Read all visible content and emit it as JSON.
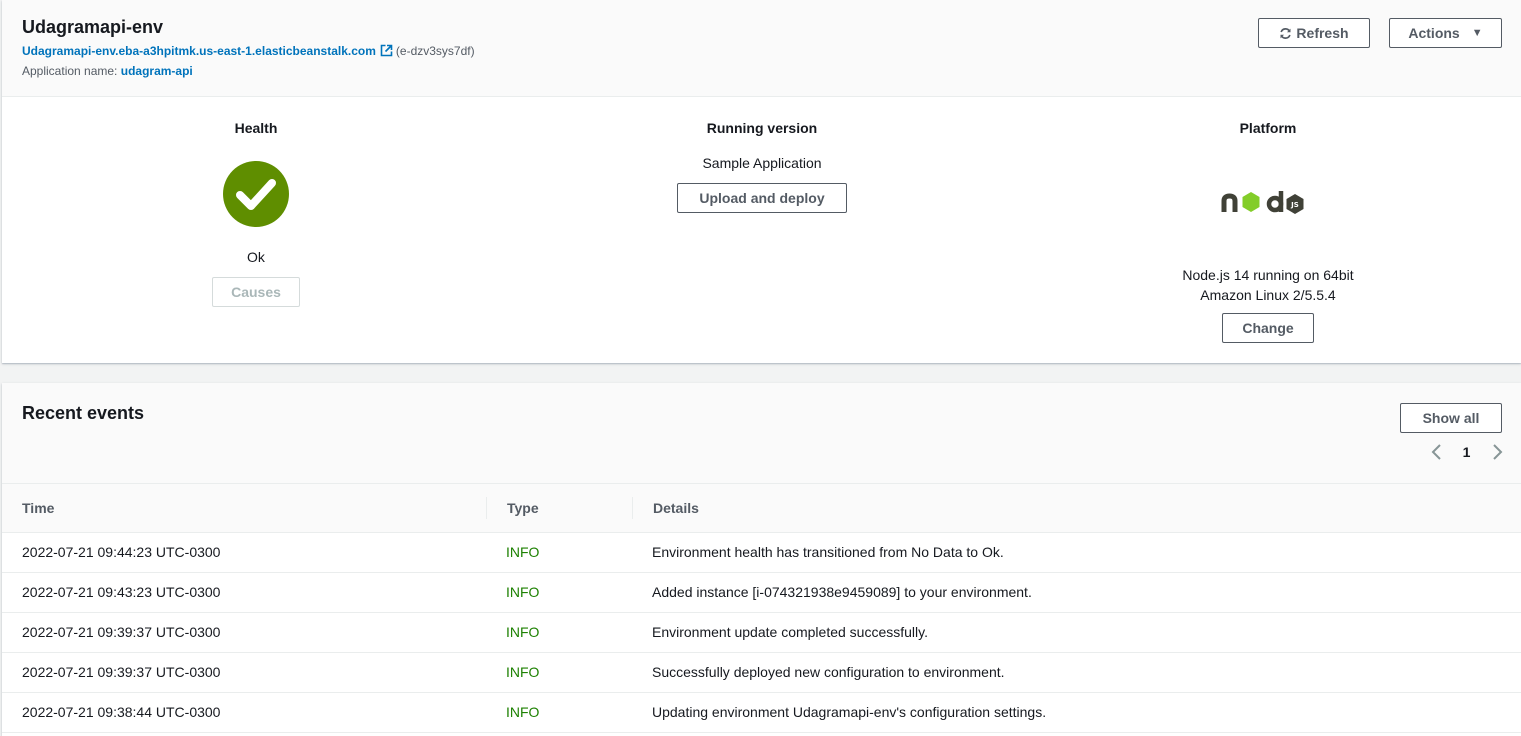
{
  "env": {
    "title": "Udagramapi-env",
    "url": "Udagramapi-env.eba-a3hpitmk.us-east-1.elasticbeanstalk.com",
    "env_id": "(e-dzv3sys7df)",
    "app_label": "Application name:",
    "app_name": "udagram-api",
    "refresh_label": "Refresh",
    "actions_label": "Actions"
  },
  "health": {
    "title": "Health",
    "status": "Ok",
    "causes_label": "Causes",
    "color": "#5f8e00"
  },
  "running_version": {
    "title": "Running version",
    "value": "Sample Application",
    "upload_label": "Upload and deploy"
  },
  "platform": {
    "title": "Platform",
    "line1": "Node.js 14 running on 64bit",
    "line2": "Amazon Linux 2/5.5.4",
    "change_label": "Change",
    "logo_icon": "nodejs-logo"
  },
  "events": {
    "title": "Recent events",
    "show_all_label": "Show all",
    "page": "1",
    "columns": [
      "Time",
      "Type",
      "Details"
    ],
    "rows": [
      {
        "time": "2022-07-21 09:44:23 UTC-0300",
        "type": "INFO",
        "details": "Environment health has transitioned from No Data to Ok."
      },
      {
        "time": "2022-07-21 09:43:23 UTC-0300",
        "type": "INFO",
        "details": "Added instance [i-074321938e9459089] to your environment."
      },
      {
        "time": "2022-07-21 09:39:37 UTC-0300",
        "type": "INFO",
        "details": "Environment update completed successfully."
      },
      {
        "time": "2022-07-21 09:39:37 UTC-0300",
        "type": "INFO",
        "details": "Successfully deployed new configuration to environment."
      },
      {
        "time": "2022-07-21 09:38:44 UTC-0300",
        "type": "INFO",
        "details": "Updating environment Udagramapi-env's configuration settings."
      }
    ]
  },
  "colors": {
    "link": "#0073bb",
    "info": "#1d8102",
    "node_green": "#83cd29",
    "node_dark": "#404137"
  }
}
